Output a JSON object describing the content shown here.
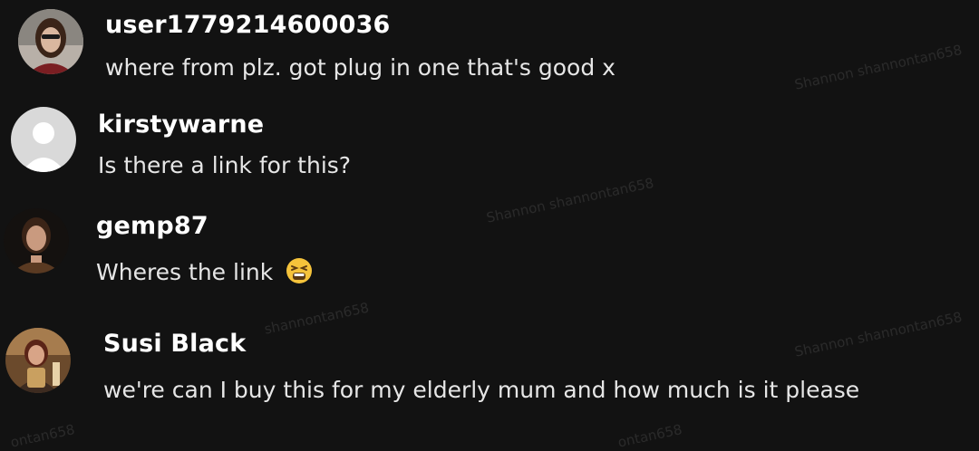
{
  "comments": [
    {
      "username": "user1779214600036",
      "text": "where from plz. got plug in one that's good x",
      "emoji": ""
    },
    {
      "username": "kirstywarne",
      "text": "Is there a link for this?",
      "emoji": ""
    },
    {
      "username": "gemp87",
      "text": "Wheres the link",
      "emoji": "tired-face-emoji"
    },
    {
      "username": "Susi Black",
      "text": "we're can I buy this for my elderly mum and how much is it please",
      "emoji": ""
    }
  ],
  "watermarks": [
    "Shannon shannontan658",
    "Shannon shannontan658",
    "shannontan658",
    "Shannon shannontan658",
    "ontan658",
    "ontan658"
  ],
  "colors": {
    "background": "#121212",
    "username": "#ffffff",
    "comment_text": "#e6e6e6",
    "default_avatar": "#d9d9d9"
  }
}
